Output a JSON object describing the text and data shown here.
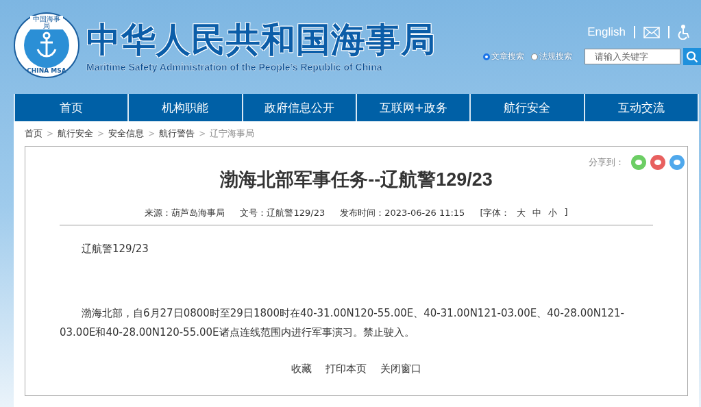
{
  "header": {
    "logo": {
      "top_text": "中国海事局",
      "bottom_text": "CHINA MSA"
    },
    "title": "中华人民共和国海事局",
    "subtitle": "Maritime Safety Administration of the People’s Republic of China",
    "english_link": "English",
    "search_scopes": [
      {
        "label": "文章搜索",
        "selected": true
      },
      {
        "label": "法规搜索",
        "selected": false
      }
    ],
    "search": {
      "placeholder": "请输入关键字"
    }
  },
  "nav": [
    {
      "label": "首页"
    },
    {
      "label": "机构职能"
    },
    {
      "label": "政府信息公开"
    },
    {
      "label": "互联网+政务"
    },
    {
      "label": "航行安全"
    },
    {
      "label": "互动交流"
    }
  ],
  "breadcrumb_separator": ">",
  "breadcrumb": [
    {
      "label": "首页"
    },
    {
      "label": "航行安全"
    },
    {
      "label": "安全信息"
    },
    {
      "label": "航行警告"
    },
    {
      "label": "辽宁海事局"
    }
  ],
  "article": {
    "share_label": "分享到：",
    "title": "渤海北部军事任务--辽航警129/23",
    "meta": {
      "source": "来源：葫芦岛海事局",
      "number": "文号：辽航警129/23",
      "time": "发布时间：2023-06-26 11:15",
      "font_label": "[字体：",
      "font_sizes": [
        "大",
        "中",
        "小"
      ],
      "font_close": "]"
    },
    "paragraphs": [
      "辽航警129/23",
      "渤海北部，自6月27日0800时至29日1800时在40-31.00N120-55.00E、40-31.00N121-03.00E、40-28.00N121-03.00E和40-28.00N120-55.00E诸点连线范围内进行军事演习。禁止驶入。"
    ],
    "actions": [
      "收藏",
      "打印本页",
      "关闭窗口"
    ]
  }
}
